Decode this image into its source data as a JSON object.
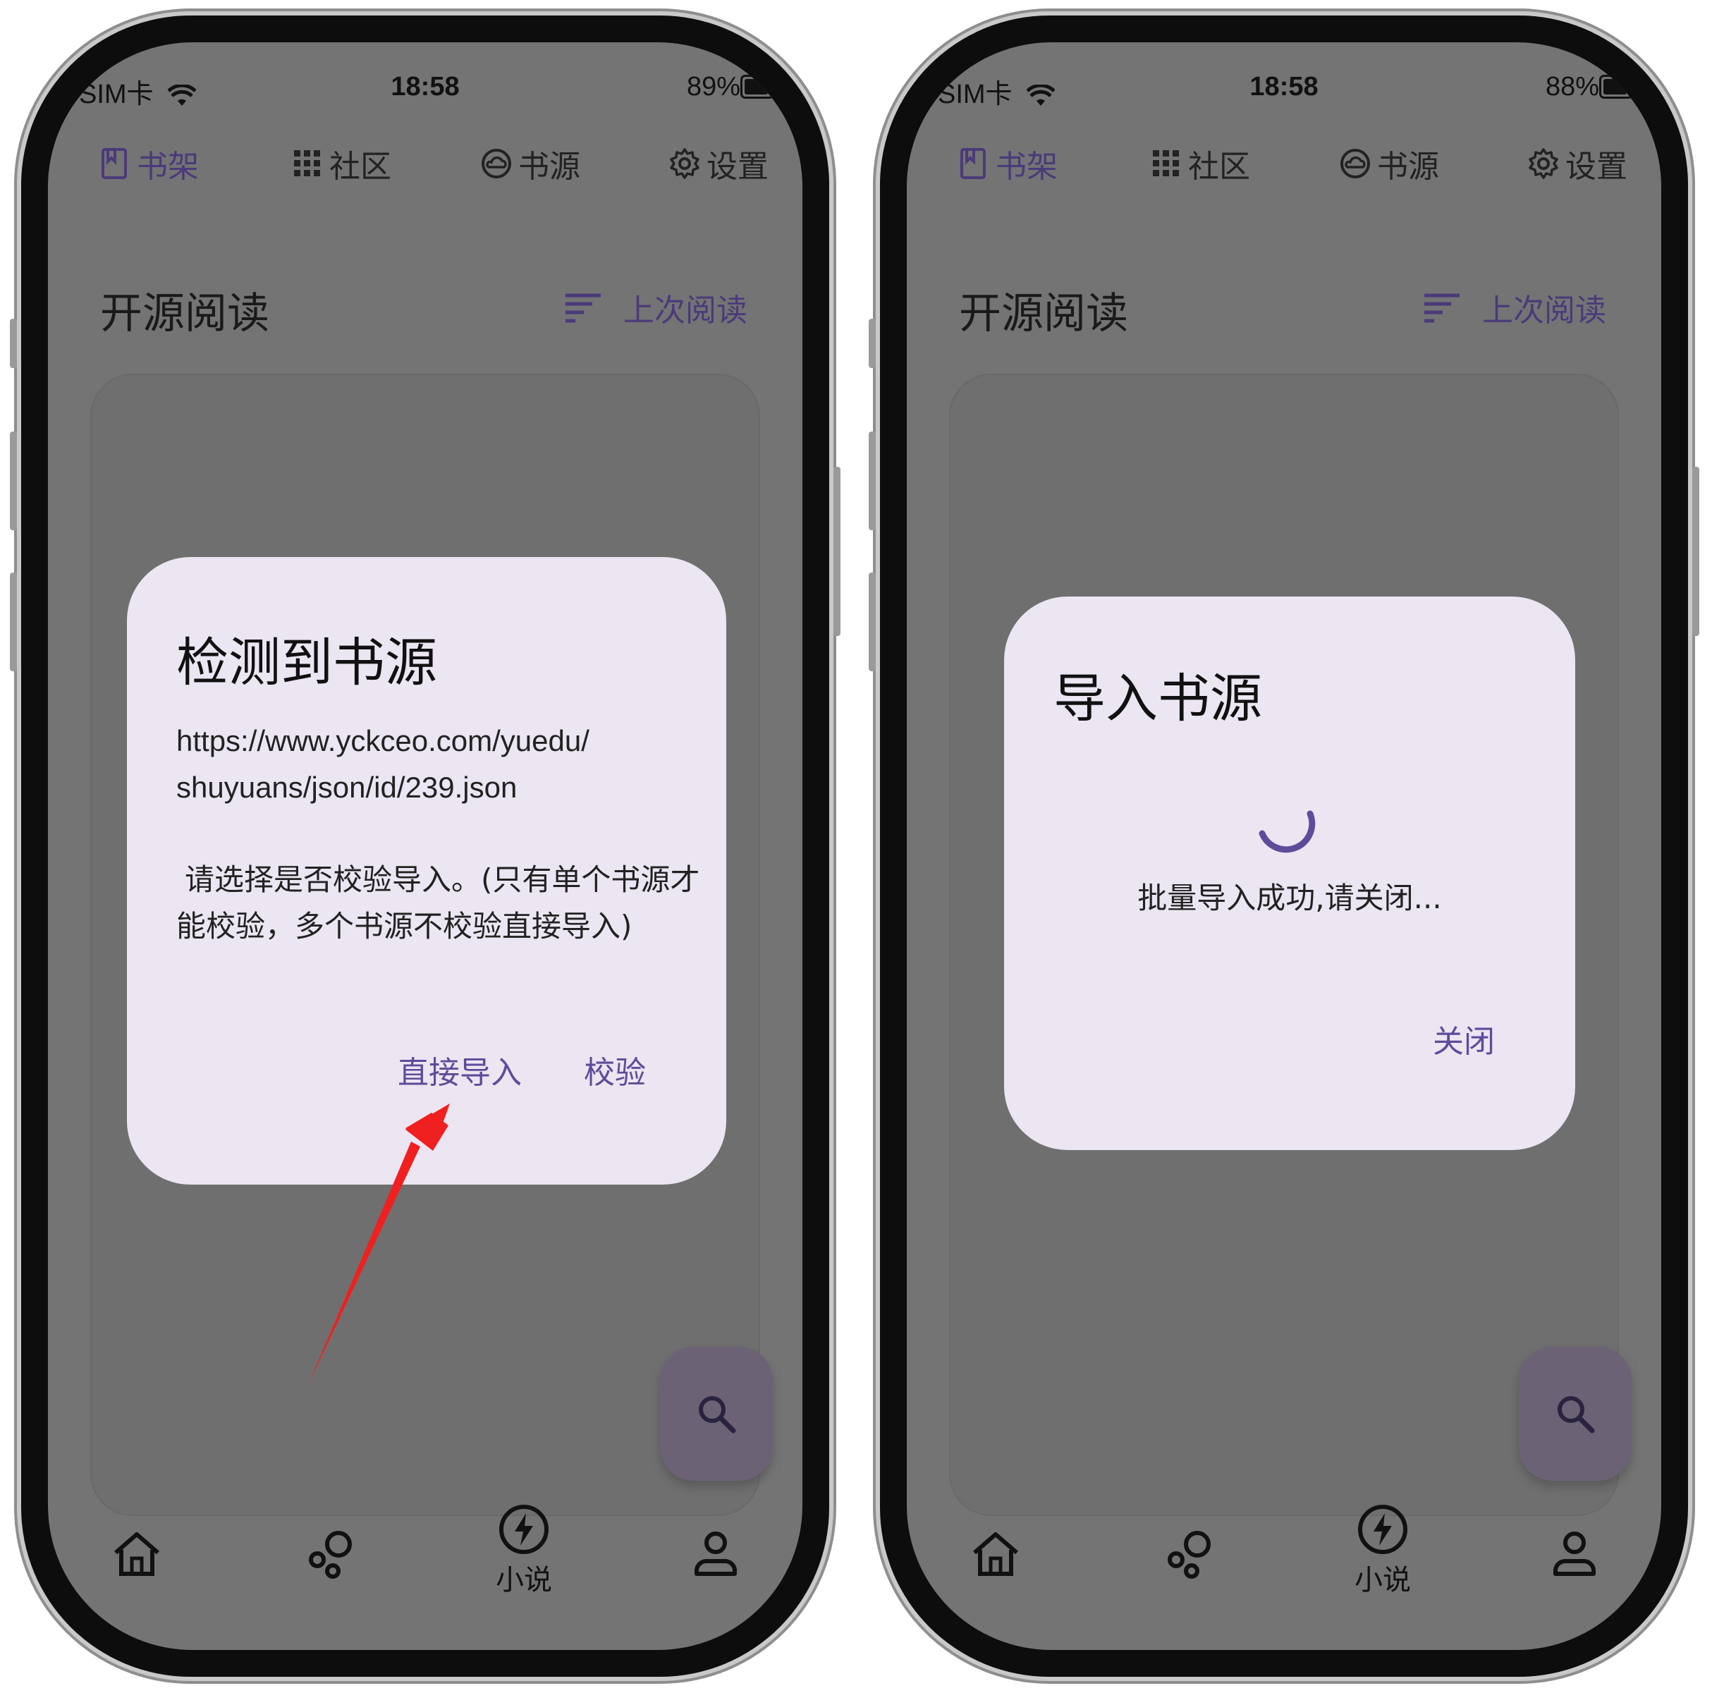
{
  "status_left": {
    "carrier": "SIM卡",
    "time": "18:58",
    "battery": "89%"
  },
  "status_right": {
    "carrier": "SIM卡",
    "time": "18:58",
    "battery": "88%"
  },
  "topnav": {
    "bookshelf": "书架",
    "community": "社区",
    "sources": "书源",
    "settings": "设置"
  },
  "page": {
    "title": "开源阅读",
    "sort_label": "上次阅读"
  },
  "bottomnav": {
    "novel": "小说"
  },
  "detect_dialog": {
    "title": "检测到书源",
    "url_line1": "https://www.yckceo.com/yuedu/",
    "url_line2": "shuyuans/json/id/239.json",
    "message_line1": "请选择是否校验导入。(只有单个书源才",
    "message_line2": "能校验，多个书源不校验直接导入)",
    "direct_import": "直接导入",
    "verify": "校验"
  },
  "import_dialog": {
    "title": "导入书源",
    "message": "批量导入成功,请关闭...",
    "close": "关闭"
  },
  "colors": {
    "accent": "#5d4c9a",
    "dialog_bg": "#ece6f2",
    "overlay": "#747474",
    "arrow": "#f02020"
  },
  "icons": [
    "book-icon",
    "grid-icon",
    "cloud-icon",
    "gear-icon",
    "sort-icon",
    "search-icon",
    "home-icon",
    "bubbles-icon",
    "bolt-icon",
    "person-icon",
    "wifi-icon"
  ]
}
